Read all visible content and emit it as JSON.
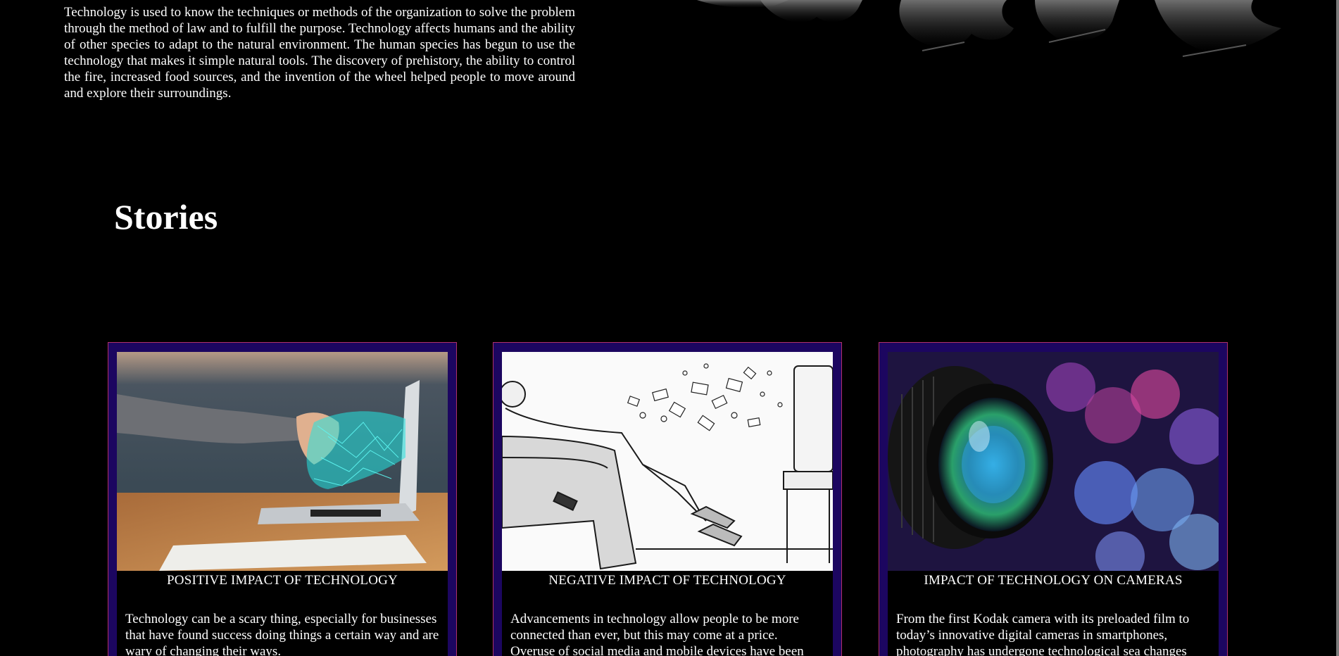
{
  "intro": {
    "text": "Technology is used to know the techniques or methods of the organization to solve the problem through the method of law and to fulfill the purpose. Technology affects humans and the ability of other species to adapt to the natural environment. The human species has begun to use the technology that makes it simple natural tools. The discovery of prehistory, the ability to control the fire, increased food sources, and the invention of the wheel helped people to move around and explore their surroundings."
  },
  "stories": {
    "heading": "Stories",
    "cards": [
      {
        "title": "POSITIVE IMPACT OF TECHNOLOGY",
        "text": "Technology can be a scary thing, especially for businesses that have found success doing things a certain way and are wary of changing their ways."
      },
      {
        "title": "NEGATIVE IMPACT OF TECHNOLOGY",
        "text": "Advancements in technology allow people to be more connected than ever, but this may come at a price. Overuse of social media and mobile devices have been"
      },
      {
        "title": "IMPACT OF TECHNOLOGY ON CAMERAS",
        "text": "From the first Kodak camera with its preloaded film to today’s innovative digital cameras in smartphones, photography has undergone technological sea changes"
      }
    ]
  },
  "colors": {
    "page_background": "#000000",
    "card_frame": "#1c0660",
    "card_border": "#b0306a"
  }
}
